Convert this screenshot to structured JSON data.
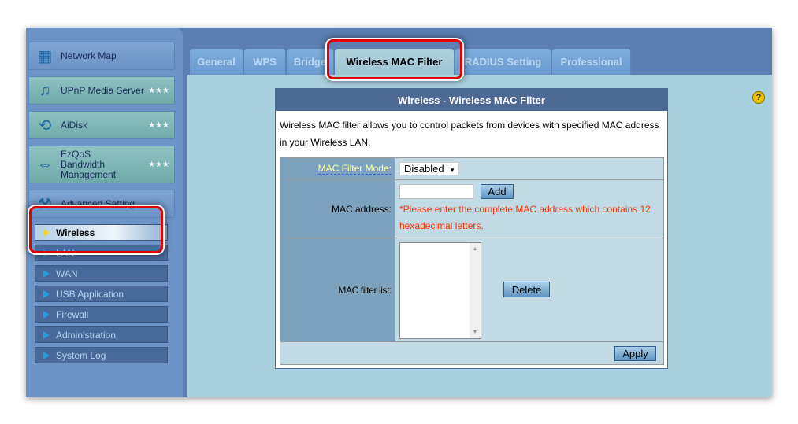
{
  "sidebar": {
    "items": [
      {
        "label": "Network Map",
        "icon": "network-map-icon",
        "stars": ""
      },
      {
        "label": "UPnP Media Server",
        "icon": "media-server-icon",
        "stars": "★★★"
      },
      {
        "label": "AiDisk",
        "icon": "aidisk-icon",
        "stars": "★★★"
      },
      {
        "label": "EzQoS Bandwidth Management",
        "icon": "ezqos-icon",
        "stars": "★★★"
      },
      {
        "label": "Advanced Setting",
        "icon": "tools-icon"
      }
    ],
    "submenu": [
      "Wireless",
      "LAN",
      "WAN",
      "USB Application",
      "Firewall",
      "Administration",
      "System Log"
    ]
  },
  "tabs": [
    "General",
    "WPS",
    "Bridge",
    "Wireless MAC Filter",
    "RADIUS Setting",
    "Professional"
  ],
  "panel": {
    "title": "Wireless - Wireless MAC Filter",
    "description": "Wireless MAC filter allows you to control packets from devices with specified MAC address in your Wireless LAN.",
    "mode_label": "MAC Filter Mode:",
    "mode_value": "Disabled",
    "mac_label": "MAC address:",
    "mac_value": "",
    "add_label": "Add",
    "mac_hint": "*Please enter the complete MAC address which contains 12 hexadecimal letters.",
    "list_label": "MAC filter list:",
    "delete_label": "Delete",
    "apply_label": "Apply"
  },
  "help": "?",
  "colors": {
    "highlight": "#e00000",
    "panel_header": "#4d6a94",
    "hint": "#ff3300"
  }
}
